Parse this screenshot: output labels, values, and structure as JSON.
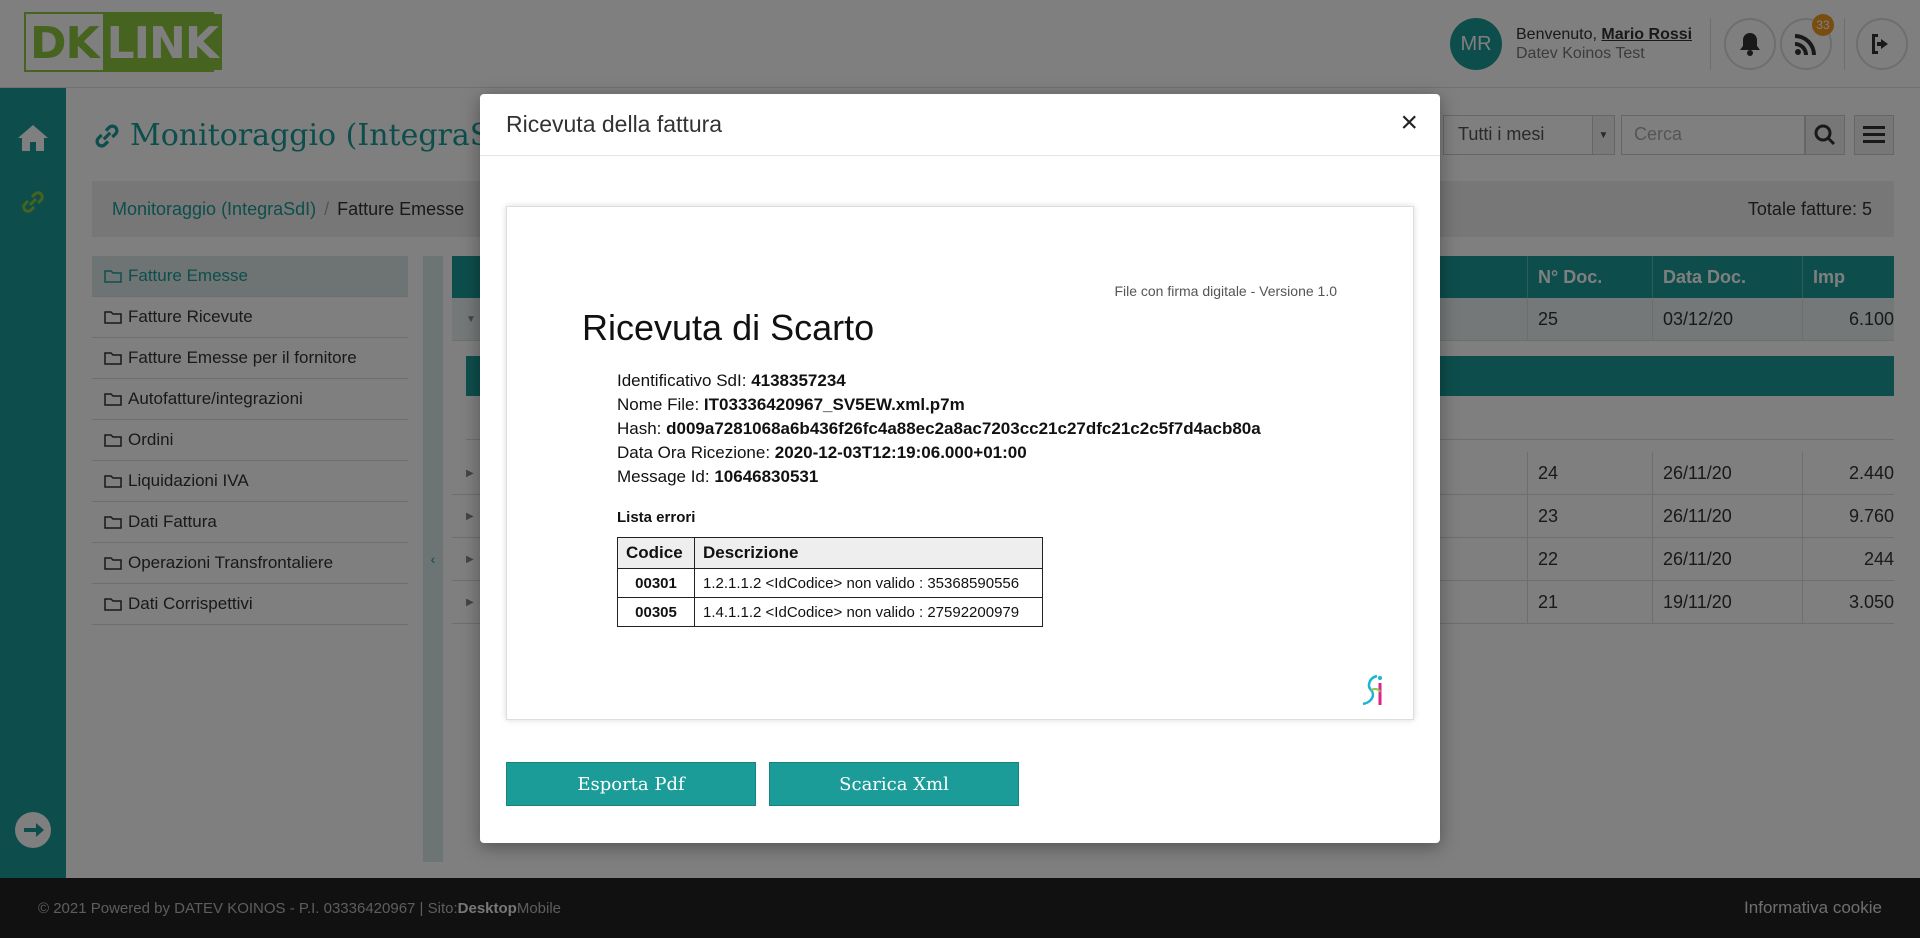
{
  "header": {
    "logo_dk": "DK",
    "logo_link": "LINK",
    "avatar_initials": "MR",
    "welcome_prefix": "Benvenuto, ",
    "user_name": "Mario Rossi",
    "org": "Datev Koinos Test",
    "rss_badge": "33"
  },
  "page": {
    "title": "Monitoraggio (IntegraSdI)",
    "month_select": "Tutti i mesi",
    "search_placeholder": "Cerca",
    "breadcrumb": [
      "Monitoraggio (IntegraSdI)",
      "Fatture Emesse"
    ],
    "total": "Totale fatture: 5"
  },
  "sidebar": {
    "items": [
      {
        "label": "Fatture Emesse"
      },
      {
        "label": "Fatture Ricevute"
      },
      {
        "label": "Fatture Emesse per il fornitore"
      },
      {
        "label": "Autofatture/integrazioni"
      },
      {
        "label": "Ordini"
      },
      {
        "label": "Liquidazioni IVA"
      },
      {
        "label": "Dati Fattura"
      },
      {
        "label": "Operazioni Transfrontaliere"
      },
      {
        "label": "Dati Corrispettivi"
      }
    ]
  },
  "table": {
    "headers": {
      "ndoc": "N° Doc.",
      "data": "Data Doc.",
      "imp": "Imp"
    },
    "rows": [
      {
        "ndoc": "25",
        "data": "03/12/20",
        "imp": "6.100"
      },
      {
        "ndoc": "24",
        "data": "26/11/20",
        "imp": "2.440"
      },
      {
        "ndoc": "23",
        "data": "26/11/20",
        "imp": "9.760"
      },
      {
        "ndoc": "22",
        "data": "26/11/20",
        "imp": "244"
      },
      {
        "ndoc": "21",
        "data": "19/11/20",
        "imp": "3.050"
      }
    ]
  },
  "modal": {
    "title": "Ricevuta della fattura",
    "close": "×",
    "export_pdf": "Esporta Pdf",
    "download_xml": "Scarica Xml",
    "doc": {
      "version": "File con firma digitale - Versione 1.0",
      "title": "Ricevuta di Scarto",
      "fields": [
        {
          "label": "Identificativo SdI: ",
          "value": "4138357234"
        },
        {
          "label": "Nome File: ",
          "value": "IT03336420967_SV5EW.xml.p7m"
        },
        {
          "label": "Hash: ",
          "value": "d009a7281068a6b436f26fc4a88ec2a8ac7203cc21c27dfc21c2c5f7d4acb80a"
        },
        {
          "label": "Data Ora Ricezione: ",
          "value": "2020-12-03T12:19:06.000+01:00"
        },
        {
          "label": "Message Id: ",
          "value": "10646830531"
        }
      ],
      "errors_label": "Lista errori",
      "errors_headers": {
        "code": "Codice",
        "desc": "Descrizione"
      },
      "errors": [
        {
          "code": "00301",
          "desc": "1.2.1.1.2 <IdCodice> non valido : 35368590556"
        },
        {
          "code": "00305",
          "desc": "1.4.1.1.2 <IdCodice> non valido : 27592200979"
        }
      ]
    }
  },
  "footer": {
    "copyright": "© 2021 Powered by DATEV KOINOS - P.I. 03336420967 | Sito: ",
    "site_desktop": "Desktop",
    "site_mobile": " Mobile",
    "cookie": "Informativa cookie"
  },
  "colors": {
    "brand": "#1b9c98",
    "logo_green": "#8dc63f",
    "badge": "#f29a1f"
  }
}
